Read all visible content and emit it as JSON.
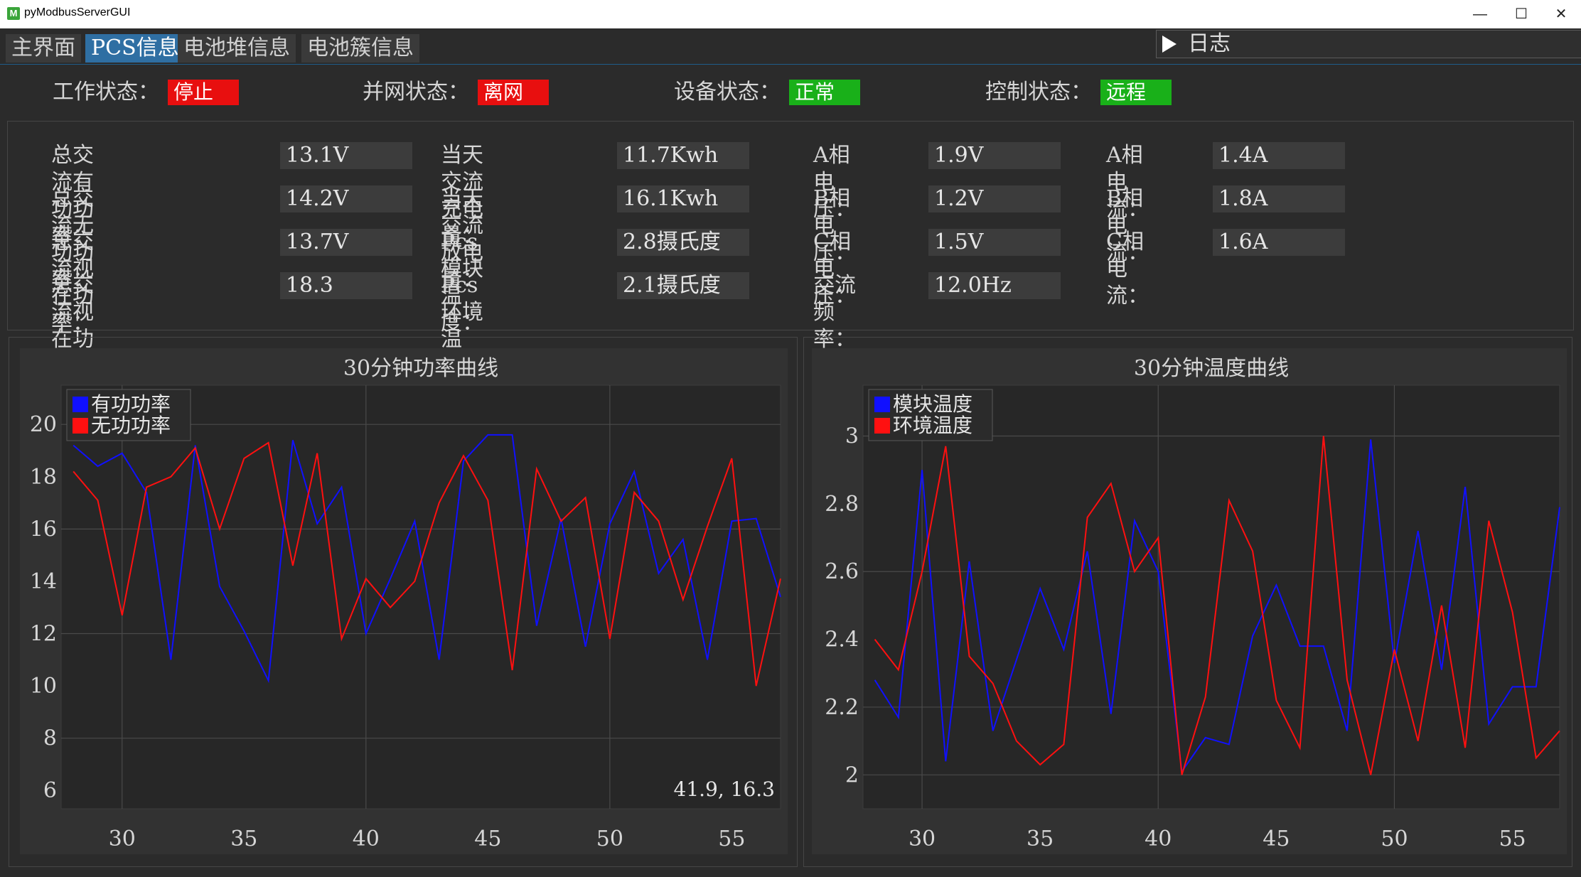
{
  "window": {
    "title": "pyModbusServerGUI",
    "minimize": "—",
    "maximize": "☐",
    "close": "✕"
  },
  "tabs": [
    {
      "label": "主界面"
    },
    {
      "label": "PCS信息"
    },
    {
      "label": "电池堆信息"
    },
    {
      "label": "电池簇信息"
    }
  ],
  "log_button": {
    "label": "日志"
  },
  "status": {
    "work": {
      "label": "工作状态：",
      "value": "停止"
    },
    "grid": {
      "label": "并网状态：",
      "value": "离网"
    },
    "device": {
      "label": "设备状态：",
      "value": "正常"
    },
    "control": {
      "label": "控制状态：",
      "value": "远程"
    }
  },
  "params": [
    [
      {
        "label": "总交流有功功率：",
        "value": "13.1V"
      },
      {
        "label": "总交流无功功率：",
        "value": "14.2V"
      },
      {
        "label": "总交流视在功率：",
        "value": "13.7V"
      },
      {
        "label": "总交流视在功率因数：",
        "value": "18.3"
      }
    ],
    [
      {
        "label": "当天交流充电量：",
        "value": "11.7Kwh"
      },
      {
        "label": "当天交流放电量：",
        "value": "16.1Kwh"
      },
      {
        "label": "Pcs模块温度：",
        "value": "2.8摄氏度"
      },
      {
        "label": "Pcs环境温度：",
        "value": "2.1摄氏度"
      }
    ],
    [
      {
        "label": "A相电压：",
        "value": "1.9V"
      },
      {
        "label": "B相电压：",
        "value": "1.2V"
      },
      {
        "label": "C相电压：",
        "value": "1.5V"
      },
      {
        "label": "交流频率：",
        "value": "12.0Hz"
      }
    ],
    [
      {
        "label": "A相电流：",
        "value": "1.4A"
      },
      {
        "label": "B相电流：",
        "value": "1.8A"
      },
      {
        "label": "C相电流：",
        "value": "1.6A"
      }
    ]
  ],
  "colors": {
    "status_red": "#e80f0f",
    "status_green": "#19b019",
    "series_blue": "#1010ff",
    "series_red": "#ff1010",
    "tab_active": "#2f6fa3"
  },
  "chart_data": [
    {
      "type": "line",
      "title": "30分钟功率曲线",
      "xlabel": "",
      "ylabel": "",
      "xlim": [
        27.5,
        57
      ],
      "ylim": [
        5.3,
        21.5
      ],
      "xticks": [
        30,
        35,
        40,
        45,
        50,
        55
      ],
      "yticks": [
        6,
        8,
        10,
        12,
        14,
        16,
        18,
        20
      ],
      "legend": "top-left",
      "cursor_readout": "41.9, 16.3",
      "x": [
        28,
        29,
        30,
        31,
        32,
        33,
        34,
        35,
        36,
        37,
        38,
        39,
        40,
        41,
        42,
        43,
        44,
        45,
        46,
        47,
        48,
        49,
        50,
        51,
        52,
        53,
        54,
        55,
        56,
        57
      ],
      "series": [
        {
          "name": "有功功率",
          "color": "#1010ff",
          "values": [
            19.2,
            18.4,
            18.9,
            17.4,
            11.0,
            19.2,
            13.8,
            12.1,
            10.2,
            19.4,
            16.2,
            17.6,
            12.0,
            14.1,
            16.3,
            11.0,
            18.6,
            19.6,
            19.6,
            12.3,
            16.4,
            11.5,
            16.2,
            18.2,
            14.3,
            15.6,
            11.0,
            16.3,
            16.4,
            13.4
          ]
        },
        {
          "name": "无功功率",
          "color": "#ff1010",
          "values": [
            18.2,
            17.1,
            12.7,
            17.6,
            18.0,
            19.1,
            16.0,
            18.7,
            19.3,
            14.6,
            18.9,
            11.8,
            14.1,
            13.0,
            14.0,
            17.0,
            18.8,
            17.1,
            10.6,
            18.3,
            16.3,
            17.2,
            11.8,
            17.4,
            16.3,
            13.3,
            16.1,
            18.7,
            10.0,
            14.1
          ]
        }
      ]
    },
    {
      "type": "line",
      "title": "30分钟温度曲线",
      "xlabel": "",
      "ylabel": "",
      "xlim": [
        27.5,
        57
      ],
      "ylim": [
        1.9,
        3.15
      ],
      "xticks": [
        30,
        35,
        40,
        45,
        50,
        55
      ],
      "yticks": [
        2,
        2.2,
        2.4,
        2.6,
        2.8,
        3
      ],
      "legend": "top-left",
      "x": [
        28,
        29,
        30,
        31,
        32,
        33,
        34,
        35,
        36,
        37,
        38,
        39,
        40,
        41,
        42,
        43,
        44,
        45,
        46,
        47,
        48,
        49,
        50,
        51,
        52,
        53,
        54,
        55,
        56,
        57
      ],
      "series": [
        {
          "name": "模块温度",
          "color": "#1010ff",
          "values": [
            2.28,
            2.17,
            2.9,
            2.04,
            2.63,
            2.13,
            2.34,
            2.55,
            2.37,
            2.66,
            2.18,
            2.75,
            2.6,
            2.01,
            2.11,
            2.09,
            2.41,
            2.56,
            2.38,
            2.38,
            2.13,
            2.99,
            2.33,
            2.72,
            2.31,
            2.85,
            2.15,
            2.26,
            2.26,
            2.79
          ]
        },
        {
          "name": "环境温度",
          "color": "#ff1010",
          "values": [
            2.4,
            2.31,
            2.6,
            2.97,
            2.35,
            2.27,
            2.1,
            2.03,
            2.09,
            2.76,
            2.86,
            2.6,
            2.7,
            2.0,
            2.23,
            2.81,
            2.66,
            2.22,
            2.08,
            3.0,
            2.28,
            2.0,
            2.37,
            2.1,
            2.5,
            2.08,
            2.75,
            2.48,
            2.05,
            2.13
          ]
        }
      ]
    }
  ]
}
